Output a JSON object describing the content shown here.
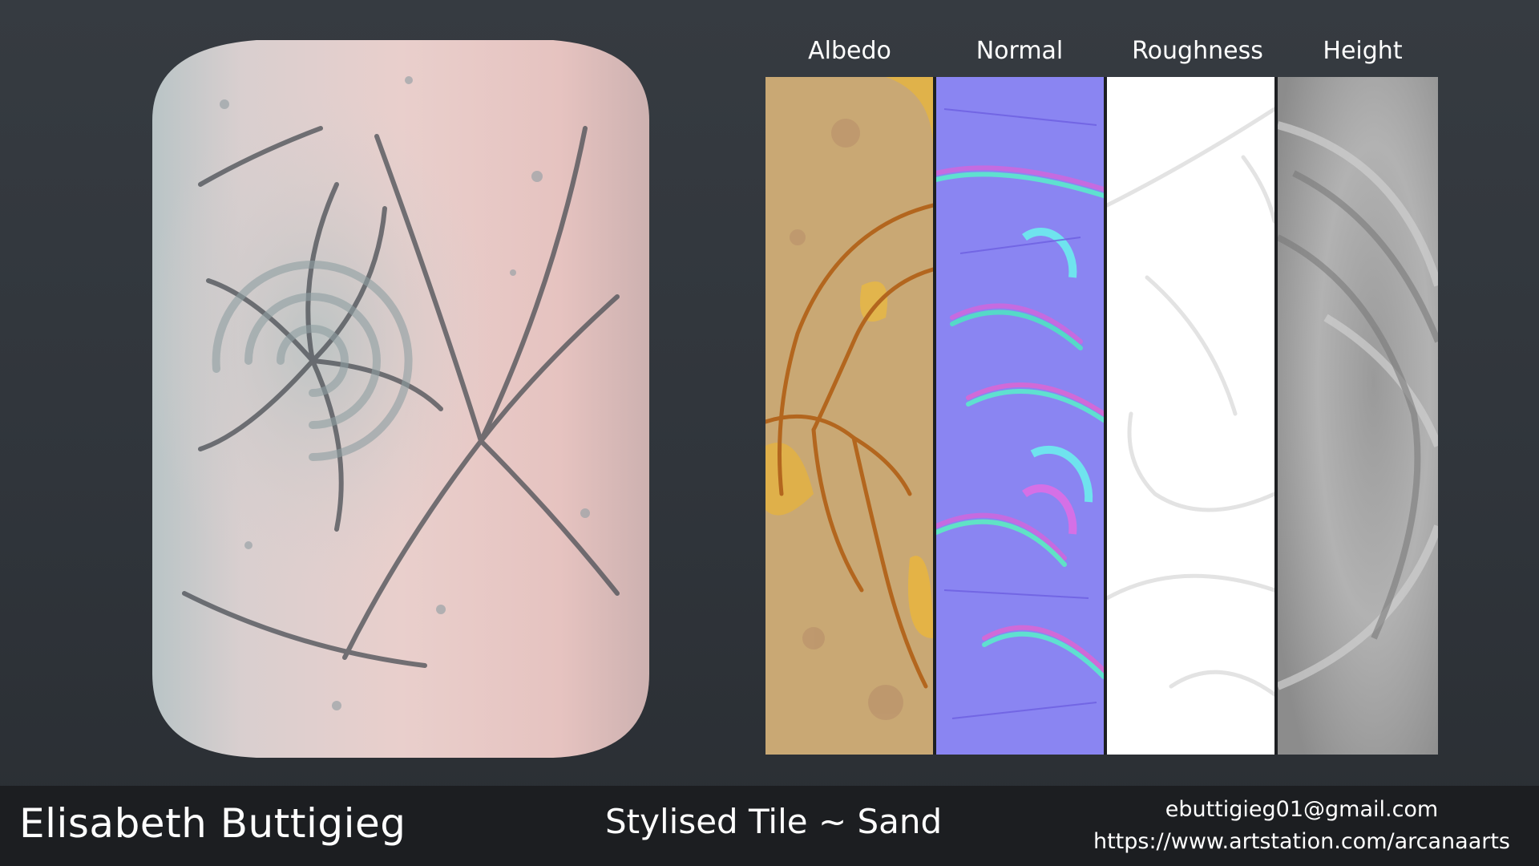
{
  "maps": [
    {
      "label": "Albedo"
    },
    {
      "label": "Normal"
    },
    {
      "label": "Roughness"
    },
    {
      "label": "Height"
    }
  ],
  "footer": {
    "author": "Elisabeth Buttigieg",
    "title": "Stylised Tile ~ Sand",
    "email": "ebuttigieg01@gmail.com",
    "url": "https://www.artstation.com/arcanaarts"
  },
  "colors": {
    "background": "#31363c",
    "footer_bar": "#1c1e21",
    "preview_tint": "#e8c6c3",
    "albedo_base": "#c9a874",
    "normal_base": "#8a85f2",
    "roughness_base": "#ffffff",
    "height_base": "#a9a9a9"
  }
}
